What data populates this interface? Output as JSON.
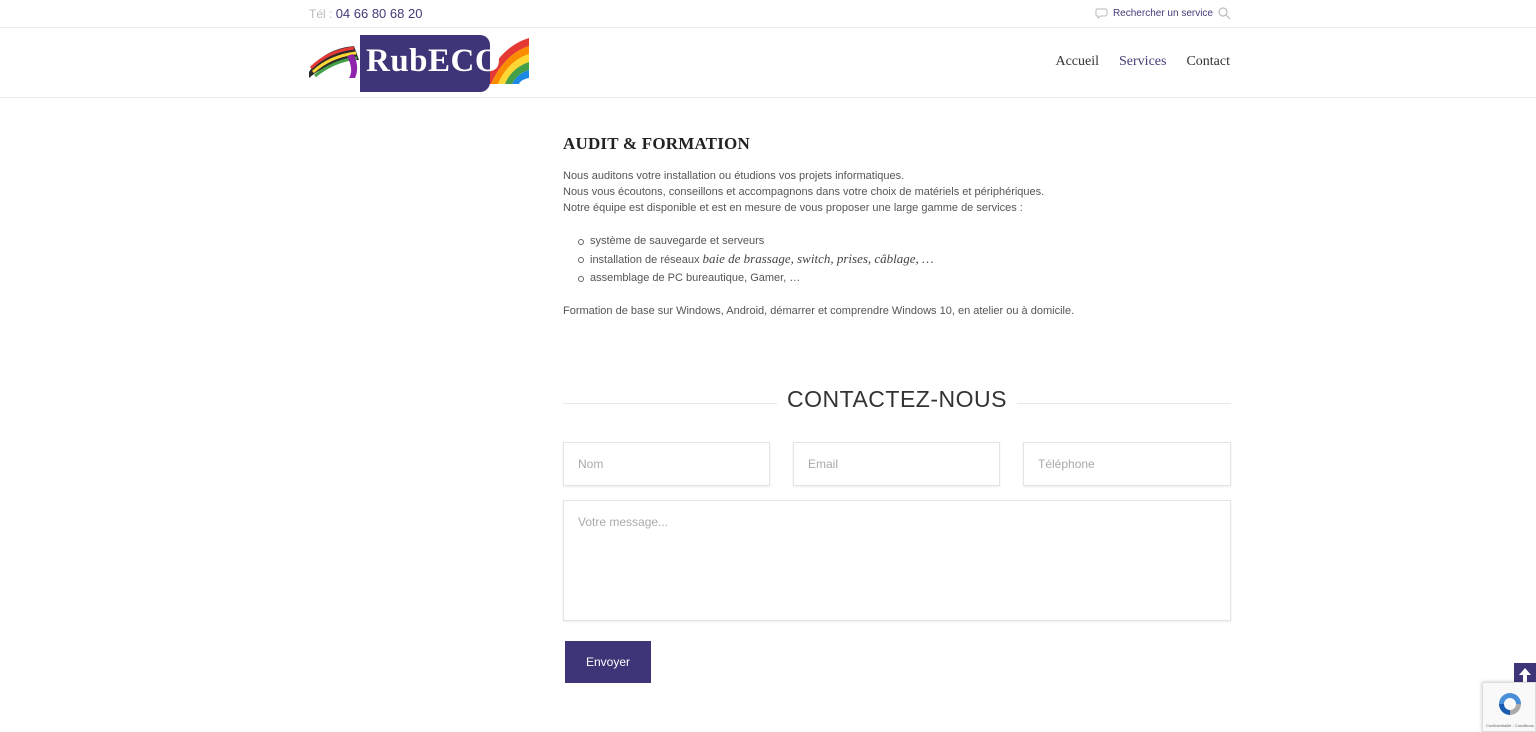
{
  "topbar": {
    "tel_label": "Tél :",
    "tel_number": "04 66 80 68 20",
    "search_label": "Rechercher un service"
  },
  "header": {
    "logo_text": "RubECO",
    "nav": [
      {
        "label": "Accueil",
        "active": false
      },
      {
        "label": "Services",
        "active": true
      },
      {
        "label": "Contact",
        "active": false
      }
    ]
  },
  "content": {
    "title": "AUDIT & FORMATION",
    "paragraphs": [
      "Nous auditons votre installation ou étudions vos projets  informatiques.",
      "Nous vous écoutons, conseillons et accompagnons dans votre choix de matériels et périphériques.",
      "Notre équipe est disponible et est en mesure de vous proposer une large gamme de services :"
    ],
    "list": [
      {
        "text": "système de sauvegarde et serveurs",
        "emphasis": ""
      },
      {
        "text": "installation de réseaux ",
        "emphasis": "baie de brassage, switch, prises, câblage, …"
      },
      {
        "text": "assemblage de PC bureautique, Gamer, …",
        "emphasis": ""
      }
    ],
    "formation": "Formation de base sur Windows, Android, démarrer et comprendre Windows 10, en atelier ou à domicile."
  },
  "contact": {
    "title": "CONTACTEZ-NOUS",
    "name_placeholder": "Nom",
    "email_placeholder": "Email",
    "phone_placeholder": "Téléphone",
    "message_placeholder": "Votre message...",
    "submit_label": "Envoyer"
  },
  "recaptcha": {
    "caption": "Confidentialité - Conditions"
  },
  "colors": {
    "brand": "#3d3578",
    "text": "#555555"
  }
}
